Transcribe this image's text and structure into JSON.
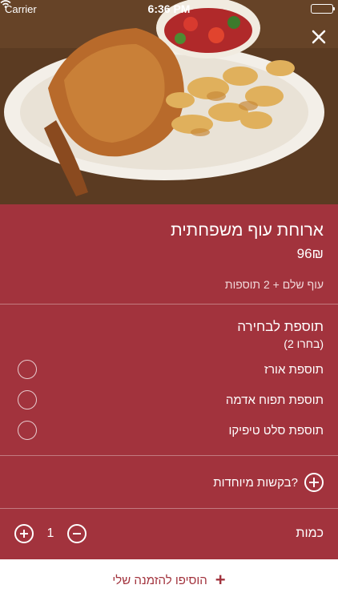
{
  "status": {
    "carrier": "Carrier",
    "time": "6:36 PM"
  },
  "hero": {
    "image": "roast-chicken-with-potatoes-and-salad"
  },
  "item": {
    "title": "ארוחת עוף משפחתית",
    "price": "96₪",
    "description": "עוף שלם + 2 תוספות"
  },
  "addons": {
    "title": "תוספת לבחירה",
    "subtitle": "(בחרו 2)",
    "options": [
      {
        "label": "תוספת אורז"
      },
      {
        "label": "תוספת תפוח אדמה"
      },
      {
        "label": "תוספת סלט טיפיקו"
      }
    ]
  },
  "special_requests": {
    "label": "בקשות מיוחדות?"
  },
  "quantity": {
    "label": "כמות",
    "value": "1"
  },
  "footer": {
    "add_to_order": "הוסיפו להזמנה שלי"
  },
  "colors": {
    "accent": "#a2333d",
    "white": "#ffffff"
  }
}
